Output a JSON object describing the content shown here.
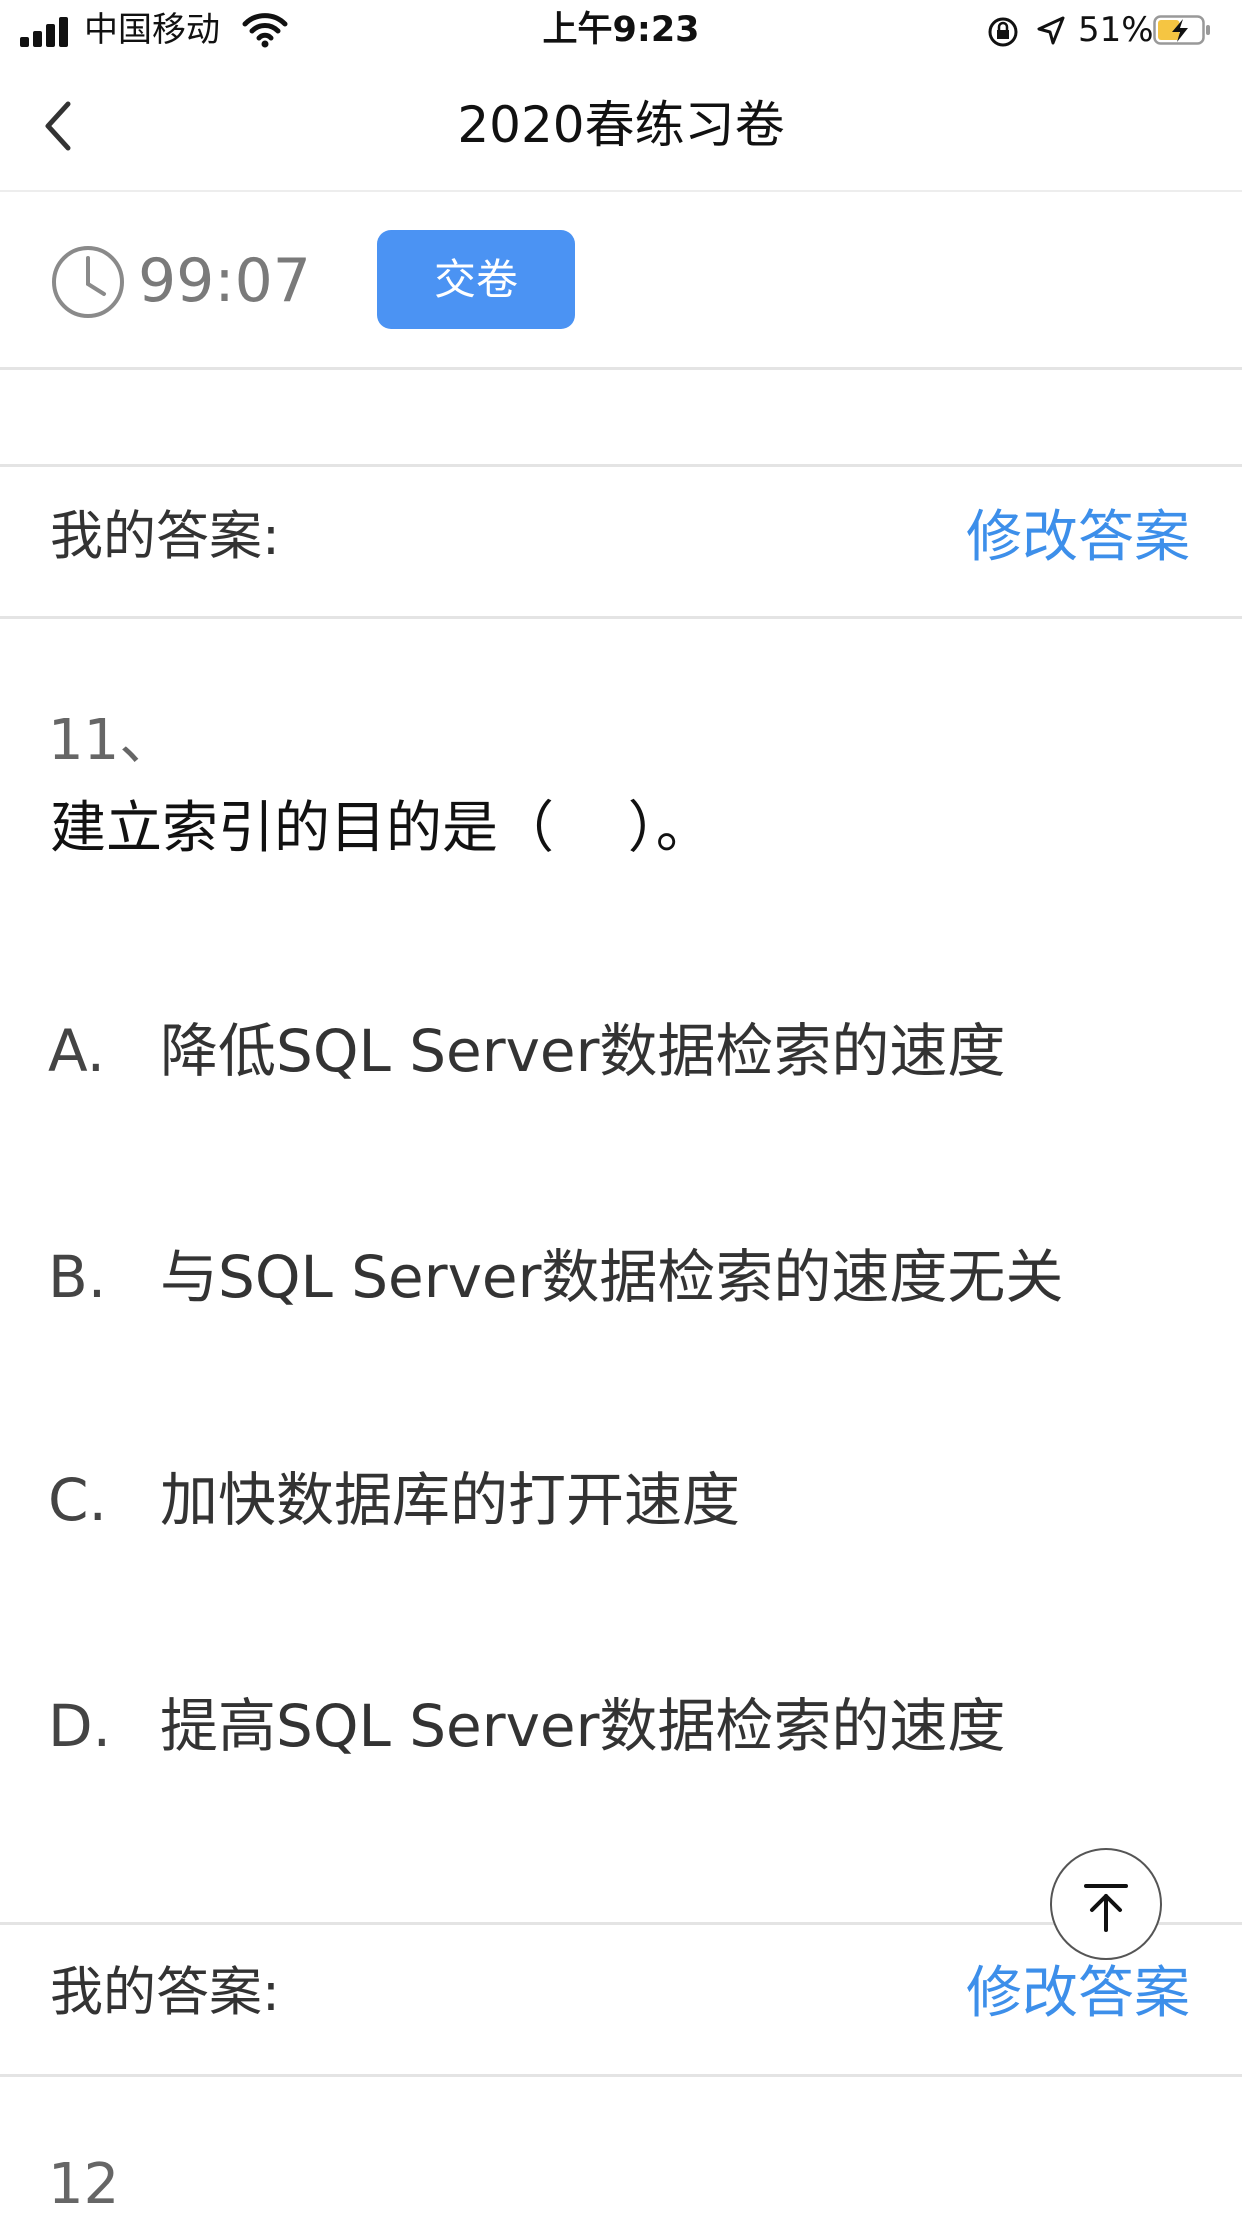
{
  "status_bar": {
    "carrier": "中国移动",
    "time": "上午9:23",
    "battery_percent": "51%",
    "battery_level": 0.51,
    "icons": [
      "signal-icon",
      "wifi-icon",
      "rotation-lock-icon",
      "location-arrow-icon",
      "battery-charging-icon"
    ]
  },
  "nav": {
    "title": "2020春练习卷",
    "back_icon": "chevron-left-icon"
  },
  "timer": {
    "icon": "clock-icon",
    "value": "99:07",
    "submit_label": "交卷"
  },
  "answer_rows": [
    {
      "label": "我的答案:",
      "action": "修改答案"
    },
    {
      "label": "我的答案:",
      "action": "修改答案"
    }
  ],
  "question": {
    "number": "11、",
    "text": "建立索引的目的是（　 ）。",
    "options": [
      {
        "letter": "A.",
        "text": "降低SQL Server数据检索的速度"
      },
      {
        "letter": "B.",
        "text": "与SQL Server数据检索的速度无关"
      },
      {
        "letter": "C.",
        "text": "加快数据库的打开速度"
      },
      {
        "letter": "D.",
        "text": "提高SQL Server数据检索的速度"
      }
    ]
  },
  "next_question_number": "12",
  "colors": {
    "accent": "#4b93f3",
    "link": "#3d8fea",
    "divider": "#e4e4e4",
    "battery_fill": "#f5c542"
  },
  "floating": {
    "icon": "arrow-to-top-icon"
  }
}
